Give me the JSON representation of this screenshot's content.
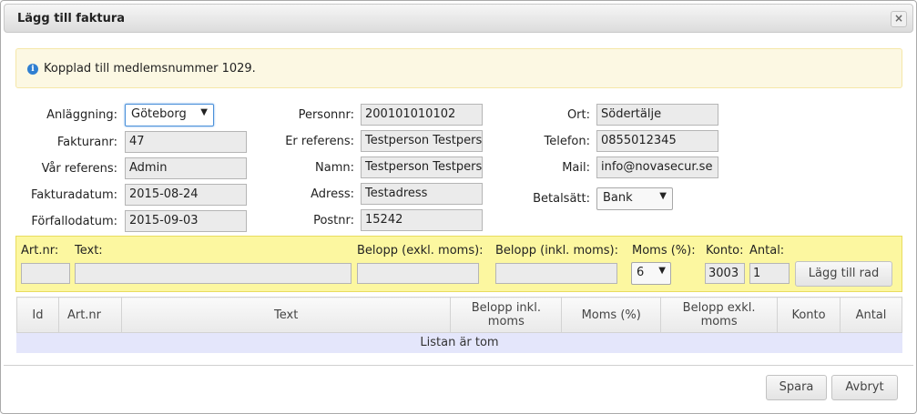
{
  "dialog": {
    "title": "Lägg till faktura",
    "close_label": "×"
  },
  "info": {
    "text": "Kopplad till medlemsnummer 1029."
  },
  "form": {
    "anlaggning": {
      "label": "Anläggning:",
      "value": "Göteborg"
    },
    "fakturanr": {
      "label": "Fakturanr:",
      "value": "47"
    },
    "var_referens": {
      "label": "Vår referens:",
      "value": "Admin"
    },
    "fakturadatum": {
      "label": "Fakturadatum:",
      "value": "2015-08-24"
    },
    "forfallodatum": {
      "label": "Förfallodatum:",
      "value": "2015-09-03"
    },
    "personnr": {
      "label": "Personnr:",
      "value": "200101010102"
    },
    "er_referens": {
      "label": "Er referens:",
      "value": "Testperson Testperson"
    },
    "namn": {
      "label": "Namn:",
      "value": "Testperson Testperson"
    },
    "adress": {
      "label": "Adress:",
      "value": "Testadress"
    },
    "postnr": {
      "label": "Postnr:",
      "value": "15242"
    },
    "ort": {
      "label": "Ort:",
      "value": "Södertälje"
    },
    "telefon": {
      "label": "Telefon:",
      "value": "0855012345"
    },
    "mail": {
      "label": "Mail:",
      "value": "info@novasecur.se"
    },
    "betalsatt": {
      "label": "Betalsätt:",
      "value": "Bank"
    }
  },
  "row_entry": {
    "artnr_label": "Art.nr:",
    "text_label": "Text:",
    "belopp_exkl_label": "Belopp (exkl. moms):",
    "belopp_inkl_label": "Belopp (inkl. moms):",
    "moms_label": "Moms (%):",
    "konto_label": "Konto:",
    "antal_label": "Antal:",
    "artnr_value": "",
    "text_value": "",
    "belopp_exkl_value": "",
    "belopp_inkl_value": "",
    "moms_value": "6",
    "konto_value": "3003",
    "antal_value": "1",
    "add_button": "Lägg till rad"
  },
  "table": {
    "columns": [
      "Id",
      "Art.nr",
      "Text",
      "Belopp inkl. moms",
      "Moms (%)",
      "Belopp exkl. moms",
      "Konto",
      "Antal"
    ],
    "empty_text": "Listan är tom"
  },
  "footer": {
    "save_label": "Spara",
    "cancel_label": "Avbryt"
  }
}
